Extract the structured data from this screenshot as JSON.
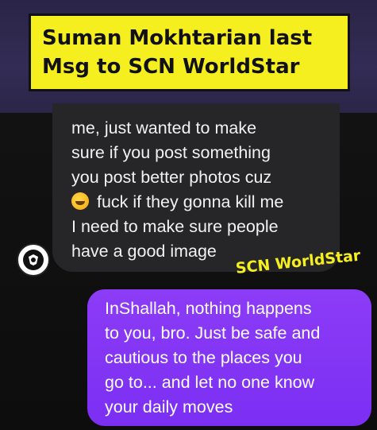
{
  "headline": {
    "line1": "Suman Mokhtarian last",
    "line2": "Msg to SCN WorldStar"
  },
  "incoming_message": {
    "lines": [
      "me, just wanted to make",
      "sure if you post something",
      "you post better photos cuz",
      " fuck if they gonna kill me",
      "I need to make sure people",
      "have a good image"
    ],
    "emoji": "rolling-on-floor-laughing-emoji"
  },
  "avatar": {
    "icon": "badge-logo-icon"
  },
  "watermark": "SCN WorldStar",
  "outgoing_message": {
    "lines": [
      "InShallah, nothing happens",
      "to you, bro. Just be safe and",
      "cautious to the places you",
      "go to... and let no one know",
      "your daily moves"
    ]
  },
  "colors": {
    "headline_bg": "#f6ef1f",
    "outgoing_bubble": "#8c3cf6",
    "incoming_bubble": "#262628",
    "header_band": "#2f2950"
  }
}
